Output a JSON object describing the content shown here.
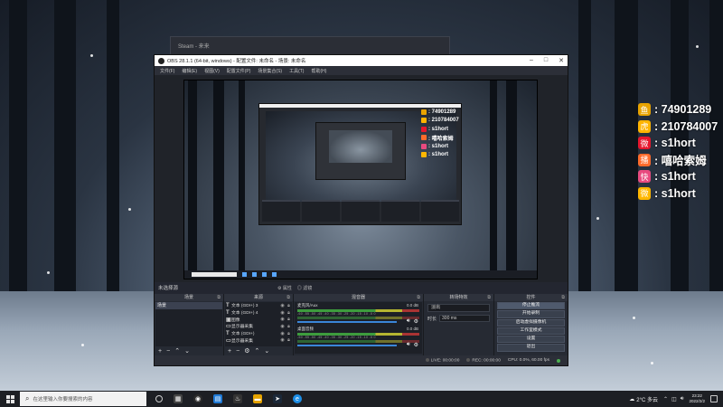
{
  "ghost_window": {
    "title": "Steam - 来来"
  },
  "obs": {
    "title": "OBS 28.1.1 (64-bit, windows) - 配置文件: 未命名 - 场景: 未命名",
    "menu": [
      "文件(F)",
      "编辑(E)",
      "视图(V)",
      "配置文件(P)",
      "场景集合(S)",
      "工具(T)",
      "帮助(H)"
    ],
    "no_source_selected": "未选择源",
    "properties_button": "属性",
    "filters_button": "滤镜",
    "docks": {
      "scenes": {
        "title": "场景",
        "items": [
          "场景"
        ]
      },
      "sources": {
        "title": "来源",
        "items": [
          {
            "icon": "T",
            "name": "文本 (GDI+) 3"
          },
          {
            "icon": "T",
            "name": "文本 (GDI+) 4"
          },
          {
            "icon": "▣",
            "name": "图像"
          },
          {
            "icon": "▭",
            "name": "显示器采集"
          },
          {
            "icon": "T",
            "name": "文本 (GDI+)"
          },
          {
            "icon": "▭",
            "name": "显示器采集"
          }
        ]
      },
      "mixer": {
        "title": "混音器",
        "channels": [
          {
            "name": "麦克风/Aux",
            "db": "0.0 dB"
          },
          {
            "name": "桌面音频",
            "db": "0.0 dB"
          }
        ],
        "ticks": "-60 -55 -50 -45 -40 -35 -30 -25 -20 -15 -10 -5 0"
      },
      "transitions": {
        "title": "转场特效",
        "type": "淡出",
        "duration_label": "时长",
        "duration": "300 ms"
      },
      "controls": {
        "title": "控件",
        "buttons": [
          "停止推流",
          "开始录制",
          "启动虚拟摄像机",
          "工作室模式",
          "设置",
          "退出"
        ]
      }
    },
    "status": {
      "live": "LIVE: 00:00:00",
      "rec": "REC: 00:00:00",
      "cpu": "CPU: 0.0%, 60.00 fps"
    }
  },
  "social": [
    {
      "icon": "douyu",
      "color": "#e8a300",
      "text": ": 74901289"
    },
    {
      "icon": "huya",
      "color": "#ffb400",
      "text": ": 210784007"
    },
    {
      "icon": "weibo",
      "color": "#e6162d",
      "text": ": s1hort"
    },
    {
      "icon": "bilibili-live",
      "color": "#ff6b2b",
      "text": ": 嘻哈索姆"
    },
    {
      "icon": "kuaishou",
      "color": "#e84a7f",
      "text": ": s1hort"
    },
    {
      "icon": "wechat",
      "color": "#ffb700",
      "text": ": s1hort"
    }
  ],
  "taskbar": {
    "search_placeholder": "在这里输入你要搜索的内容",
    "weather": "2°C 多云",
    "time": "23:22",
    "date": "2022/2/2"
  }
}
